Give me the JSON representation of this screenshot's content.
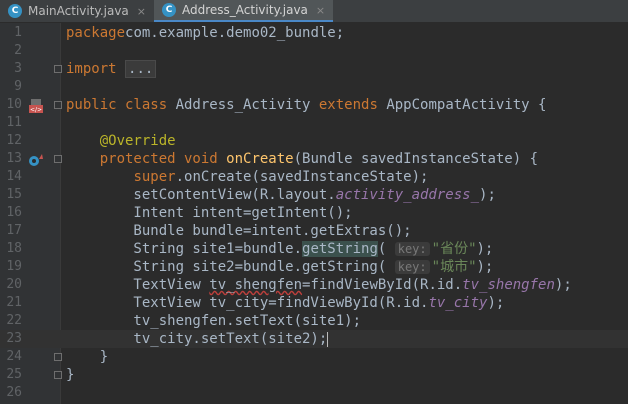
{
  "tabs": [
    {
      "label": "MainActivity.java",
      "icon": "java-class-icon",
      "close": "×",
      "active": false
    },
    {
      "label": "Address_Activity.java",
      "icon": "java-class-icon",
      "close": "×",
      "active": true
    }
  ],
  "file_icon_letter": "C",
  "lines": [
    {
      "n": "1",
      "tokens": [
        [
          "kw",
          "package"
        ],
        [
          "",
          "com.example.demo02_bundle;"
        ]
      ]
    },
    {
      "n": "2",
      "tokens": []
    },
    {
      "n": "3",
      "tokens": [
        [
          "kw",
          "import"
        ],
        [
          "",
          " "
        ],
        [
          "fold",
          "..."
        ]
      ]
    },
    {
      "n": "9",
      "tokens": []
    },
    {
      "n": "10",
      "tokens": [
        [
          "kw",
          "public class "
        ],
        [
          "",
          "Address_Activity "
        ],
        [
          "kw",
          "extends "
        ],
        [
          "",
          "AppCompatActivity {"
        ]
      ]
    },
    {
      "n": "11",
      "tokens": []
    },
    {
      "n": "12",
      "tokens": [
        [
          "",
          "    "
        ],
        [
          "ann",
          "@Override"
        ]
      ]
    },
    {
      "n": "13",
      "tokens": [
        [
          "",
          "    "
        ],
        [
          "kw",
          "protected void "
        ],
        [
          "fn",
          "onCreate"
        ],
        [
          "",
          "(Bundle savedInstanceState) {"
        ]
      ]
    },
    {
      "n": "14",
      "tokens": [
        [
          "",
          "        "
        ],
        [
          "kw",
          "super"
        ],
        [
          "",
          ".onCreate(savedInstanceState);"
        ]
      ]
    },
    {
      "n": "15",
      "tokens": [
        [
          "",
          "        setContentView(R.layout."
        ],
        [
          "fld",
          "activity_address_"
        ],
        [
          "",
          ");"
        ]
      ]
    },
    {
      "n": "16",
      "tokens": [
        [
          "",
          "        Intent intent=getIntent();"
        ]
      ]
    },
    {
      "n": "17",
      "tokens": [
        [
          "",
          "        Bundle bundle=intent.getExtras();"
        ]
      ]
    },
    {
      "n": "18",
      "tokens": [
        [
          "",
          "        String site1=bundle."
        ],
        [
          "hl-match",
          "getString"
        ],
        [
          "",
          "( "
        ],
        [
          "hint",
          "key:"
        ],
        [
          "str",
          "\"省份\""
        ],
        [
          "",
          ");"
        ]
      ]
    },
    {
      "n": "19",
      "tokens": [
        [
          "",
          "        String site2=bundle.getString( "
        ],
        [
          "hint",
          "key:"
        ],
        [
          "str",
          "\"城市\""
        ],
        [
          "",
          ");"
        ]
      ]
    },
    {
      "n": "20",
      "tokens": [
        [
          "",
          "        TextView "
        ],
        [
          "warn",
          "tv_shengfen"
        ],
        [
          "",
          "=findViewById(R.id."
        ],
        [
          "fld",
          "tv_shengfen"
        ],
        [
          "",
          ");"
        ]
      ]
    },
    {
      "n": "21",
      "tokens": [
        [
          "",
          "        TextView tv_city=findViewById(R.id."
        ],
        [
          "fld",
          "tv_city"
        ],
        [
          "",
          ");"
        ]
      ]
    },
    {
      "n": "22",
      "tokens": [
        [
          "",
          "        tv_shengfen.setText(site1);"
        ]
      ]
    },
    {
      "n": "23",
      "tokens": [
        [
          "",
          "        tv_city.setText(site2);"
        ],
        [
          "caret",
          ""
        ]
      ]
    },
    {
      "n": "24",
      "tokens": [
        [
          "",
          "    }"
        ]
      ]
    },
    {
      "n": "25",
      "tokens": [
        [
          "",
          "}"
        ]
      ]
    },
    {
      "n": "26",
      "tokens": []
    }
  ],
  "colors": {
    "background": "#2b2b2b",
    "keyword": "#cc7832",
    "annotation": "#bbb529",
    "method": "#ffc66d",
    "string": "#6a8759",
    "field": "#9876aa",
    "text": "#a9b7c6",
    "line_number": "#606366"
  }
}
